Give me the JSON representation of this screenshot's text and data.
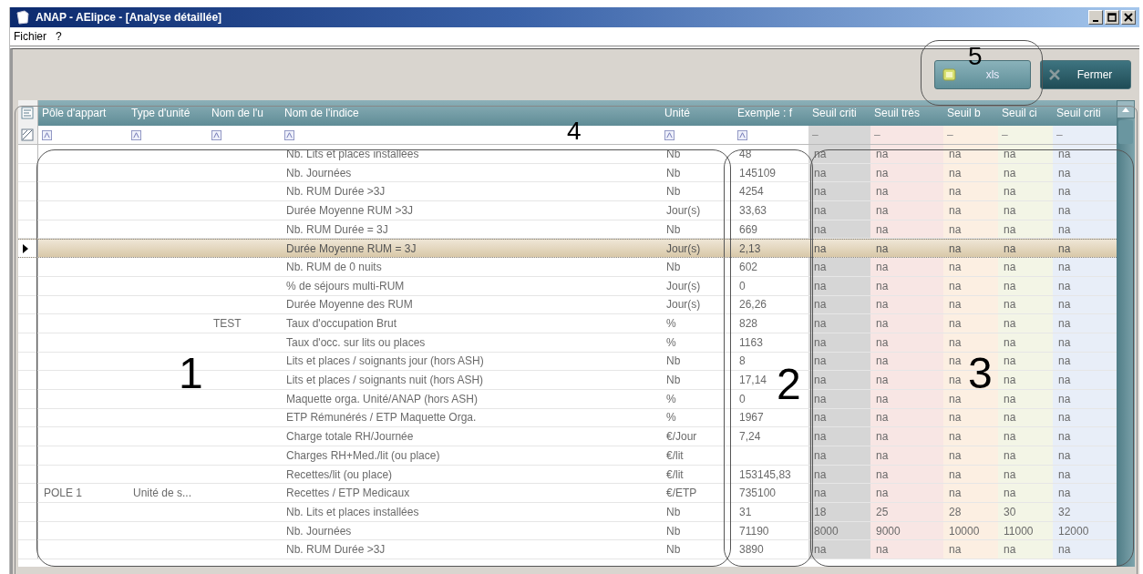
{
  "window": {
    "title": "ANAP - AElipce - [Analyse détaillée]"
  },
  "menu": [
    {
      "label": "Fichier"
    },
    {
      "label": "?"
    }
  ],
  "toolbar": {
    "buttons": [
      {
        "label": "xls",
        "kind": "export"
      },
      {
        "label": "Fermer",
        "kind": "close"
      }
    ]
  },
  "table": {
    "columns": [
      {
        "label": "Pôle d'appart",
        "kind": "text"
      },
      {
        "label": "Type d'unité",
        "kind": "text"
      },
      {
        "label": "Nom de l'u",
        "kind": "text"
      },
      {
        "label": "Nom de l'indice",
        "kind": "text"
      },
      {
        "label": "Unité",
        "kind": "text"
      },
      {
        "label": "Exemple : f",
        "kind": "text"
      },
      {
        "label": "Seuil criti",
        "kind": "threshold",
        "filter": "–",
        "color": "#d6d6d6"
      },
      {
        "label": "Seuil très",
        "kind": "threshold",
        "filter": "–",
        "color": "#f8e6e4"
      },
      {
        "label": "Seuil b",
        "kind": "threshold",
        "filter": "–",
        "color": "#fcefe2"
      },
      {
        "label": "Seuil ci",
        "kind": "threshold",
        "filter": "–",
        "color": "#f3f5e6"
      },
      {
        "label": "Seuil criti",
        "kind": "threshold",
        "filter": "–",
        "color": "#e8eef8"
      }
    ],
    "rows": [
      {
        "indice": "Nb. Lits et places installées",
        "unite": "Nb",
        "exemple": "48",
        "seuils": [
          "na",
          "na",
          "na",
          "na",
          "na"
        ],
        "selected": false
      },
      {
        "indice": "Nb. Journées",
        "unite": "Nb",
        "exemple": "145109",
        "seuils": [
          "na",
          "na",
          "na",
          "na",
          "na"
        ],
        "selected": false
      },
      {
        "indice": "Nb. RUM Durée >3J",
        "unite": "Nb",
        "exemple": "4254",
        "seuils": [
          "na",
          "na",
          "na",
          "na",
          "na"
        ],
        "selected": false
      },
      {
        "indice": "Durée Moyenne RUM >3J",
        "unite": "Jour(s)",
        "exemple": "33,63",
        "seuils": [
          "na",
          "na",
          "na",
          "na",
          "na"
        ],
        "selected": false
      },
      {
        "indice": "Nb. RUM Durée = 3J",
        "unite": "Nb",
        "exemple": "669",
        "seuils": [
          "na",
          "na",
          "na",
          "na",
          "na"
        ],
        "selected": false
      },
      {
        "indice": "Durée Moyenne RUM = 3J",
        "unite": "Jour(s)",
        "exemple": "2,13",
        "seuils": [
          "na",
          "na",
          "na",
          "na",
          "na"
        ],
        "selected": true
      },
      {
        "indice": "Nb. RUM de 0 nuits",
        "unite": "Nb",
        "exemple": "602",
        "seuils": [
          "na",
          "na",
          "na",
          "na",
          "na"
        ],
        "selected": false
      },
      {
        "indice": "% de séjours multi-RUM",
        "unite": "Jour(s)",
        "exemple": "0",
        "seuils": [
          "na",
          "na",
          "na",
          "na",
          "na"
        ],
        "selected": false
      },
      {
        "indice": "Durée Moyenne des RUM",
        "unite": "Jour(s)",
        "exemple": "26,26",
        "seuils": [
          "na",
          "na",
          "na",
          "na",
          "na"
        ],
        "selected": false
      },
      {
        "nom_unite": "TEST",
        "indice": "Taux d'occupation Brut",
        "unite": "%",
        "exemple": "828",
        "seuils": [
          "na",
          "na",
          "na",
          "na",
          "na"
        ],
        "selected": false
      },
      {
        "indice": "Taux d'occ. sur lits ou places",
        "unite": "%",
        "exemple": "1163",
        "seuils": [
          "na",
          "na",
          "na",
          "na",
          "na"
        ],
        "selected": false
      },
      {
        "indice": "Lits et places / soignants jour  (hors ASH)",
        "unite": "Nb",
        "exemple": "8",
        "seuils": [
          "na",
          "na",
          "na",
          "na",
          "na"
        ],
        "selected": false
      },
      {
        "indice": "Lits et places / soignants nuit  (hors ASH)",
        "unite": "Nb",
        "exemple": "17,14",
        "seuils": [
          "na",
          "na",
          "na",
          "na",
          "na"
        ],
        "selected": false
      },
      {
        "indice": "Maquette orga. Unité/ANAP  (hors ASH)",
        "unite": "%",
        "exemple": "0",
        "seuils": [
          "na",
          "na",
          "na",
          "na",
          "na"
        ],
        "selected": false
      },
      {
        "indice": "ETP Rémunérés / ETP Maquette Orga.",
        "unite": "%",
        "exemple": "1967",
        "seuils": [
          "na",
          "na",
          "na",
          "na",
          "na"
        ],
        "selected": false
      },
      {
        "indice": "Charge totale RH/Journée",
        "unite": "€/Jour",
        "exemple": "7,24",
        "seuils": [
          "na",
          "na",
          "na",
          "na",
          "na"
        ],
        "selected": false
      },
      {
        "indice": "Charges RH+Med./lit (ou place)",
        "unite": "€/lit",
        "seuils": [
          "na",
          "na",
          "na",
          "na",
          "na"
        ],
        "selected": false
      },
      {
        "indice": "Recettes/lit (ou place)",
        "unite": "€/lit",
        "exemple": "153145,83",
        "seuils": [
          "na",
          "na",
          "na",
          "na",
          "na"
        ],
        "selected": false
      },
      {
        "pole": "POLE 1",
        "type": "Unité de s...",
        "indice": "Recettes / ETP Medicaux",
        "unite": "€/ETP",
        "exemple": "735100",
        "seuils": [
          "na",
          "na",
          "na",
          "na",
          "na"
        ],
        "selected": false
      },
      {
        "indice": "Nb. Lits et places installées",
        "unite": "Nb",
        "exemple": "31",
        "seuils": [
          "18",
          "25",
          "28",
          "30",
          "32"
        ],
        "selected": false
      },
      {
        "indice": "Nb. Journées",
        "unite": "Nb",
        "exemple": "71190",
        "seuils": [
          "8000",
          "9000",
          "10000",
          "11000",
          "12000"
        ],
        "selected": false
      },
      {
        "indice": "Nb. RUM Durée >3J",
        "unite": "Nb",
        "exemple": "3890",
        "seuils": [
          "na",
          "na",
          "na",
          "na",
          "na"
        ],
        "selected": false
      }
    ]
  },
  "callouts": [
    {
      "label": "1"
    },
    {
      "label": "2"
    },
    {
      "label": "3"
    },
    {
      "label": "4"
    },
    {
      "label": "5"
    }
  ]
}
